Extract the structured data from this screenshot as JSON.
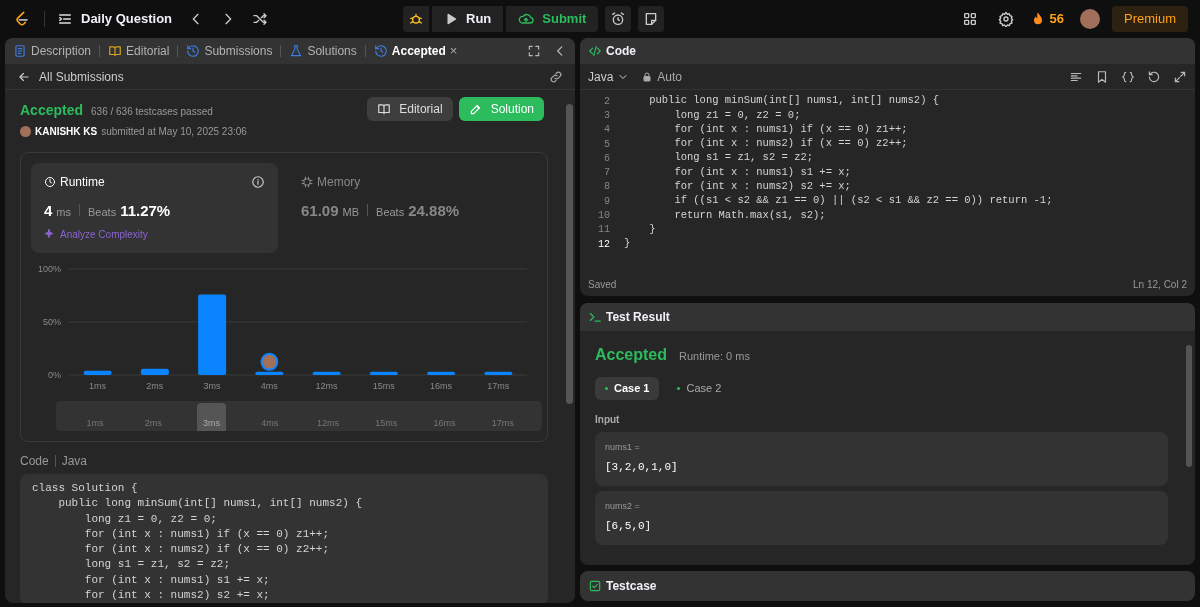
{
  "top_bar": {
    "title": "Daily Question",
    "run_label": "Run",
    "submit_label": "Submit",
    "streak": "56",
    "premium_label": "Premium"
  },
  "left_panel": {
    "tabs": [
      {
        "label": "Description",
        "selected": false
      },
      {
        "label": "Editorial",
        "selected": false
      },
      {
        "label": "Submissions",
        "selected": false
      },
      {
        "label": "Solutions",
        "selected": false
      },
      {
        "label": "Accepted",
        "selected": true,
        "close_glyph": "×"
      }
    ],
    "back_label": "All Submissions",
    "status": "Accepted",
    "testcases": "636 / 636 testcases passed",
    "user": "KANISHK KS",
    "submitted": "submitted at May 10, 2025 23:06",
    "editorial_button": "Editorial",
    "solution_button": "Solution",
    "runtime": {
      "title": "Runtime",
      "value": "4",
      "unit": "ms",
      "beats_label": "Beats",
      "beats": "11.27%",
      "analyze": "Analyze Complexity",
      "selected": true
    },
    "memory": {
      "title": "Memory",
      "value": "61.09",
      "unit": "MB",
      "beats_label": "Beats",
      "beats": "24.88%",
      "selected": false
    },
    "chart_data": {
      "type": "bar",
      "categories": [
        "1ms",
        "2ms",
        "3ms",
        "4ms",
        "12ms",
        "15ms",
        "16ms",
        "17ms"
      ],
      "values": [
        4,
        6,
        76,
        3,
        3,
        3,
        3,
        3
      ],
      "ylim": [
        0,
        100
      ],
      "yticks": [
        {
          "value": 0,
          "label": "0%"
        },
        {
          "value": 50,
          "label": "50%"
        },
        {
          "value": 100,
          "label": "100%"
        }
      ],
      "annotations": [
        {
          "x": "4ms"
        }
      ]
    },
    "navigator": [
      {
        "label": "1ms",
        "selected": false
      },
      {
        "label": "2ms",
        "selected": false
      },
      {
        "label": "3ms",
        "selected": true
      },
      {
        "label": "4ms",
        "selected": false
      },
      {
        "label": "12ms",
        "selected": false
      },
      {
        "label": "15ms",
        "selected": false
      },
      {
        "label": "16ms",
        "selected": false
      },
      {
        "label": "17ms",
        "selected": false
      }
    ],
    "code_label": "Code",
    "language": "Java",
    "code": [
      "class Solution {",
      "    public long minSum(int[] nums1, int[] nums2) {",
      "        long z1 = 0, z2 = 0;",
      "        for (int x : nums1) if (x == 0) z1++;",
      "        for (int x : nums2) if (x == 0) z2++;",
      "        long s1 = z1, s2 = z2;",
      "        for (int x : nums1) s1 += x;",
      "        for (int x : nums2) s2 += x;"
    ]
  },
  "code_panel": {
    "title": "Code",
    "language": "Java",
    "mode": "Auto",
    "lines": [
      {
        "number": "2",
        "text": "    public long minSum(int[] nums1, int[] nums2) {"
      },
      {
        "number": "3",
        "text": "        long z1 = 0, z2 = 0;"
      },
      {
        "number": "4",
        "text": "        for (int x : nums1) if (x == 0) z1++;"
      },
      {
        "number": "5",
        "text": "        for (int x : nums2) if (x == 0) z2++;"
      },
      {
        "number": "6",
        "text": "        long s1 = z1, s2 = z2;"
      },
      {
        "number": "7",
        "text": "        for (int x : nums1) s1 += x;"
      },
      {
        "number": "8",
        "text": "        for (int x : nums2) s2 += x;"
      },
      {
        "number": "9",
        "text": "        if ((s1 < s2 && z1 == 0) || (s2 < s1 && z2 == 0)) return -1;"
      },
      {
        "number": "10",
        "text": "        return Math.max(s1, s2);"
      },
      {
        "number": "11",
        "text": "    }"
      },
      {
        "number": "12",
        "text": "}"
      }
    ],
    "saved": "Saved",
    "cursor": "Ln 12, Col 2"
  },
  "test_result": {
    "title": "Test Result",
    "status": "Accepted",
    "runtime": "Runtime: 0 ms",
    "cases": [
      {
        "label": "Case 1",
        "selected": true
      },
      {
        "label": "Case 2",
        "selected": false
      }
    ],
    "input_label": "Input",
    "inputs": [
      {
        "name": "nums1 =",
        "value": "[3,2,0,1,0]"
      },
      {
        "name": "nums2 =",
        "value": "[6,5,0]"
      }
    ]
  },
  "testcase_panel": {
    "title": "Testcase"
  }
}
